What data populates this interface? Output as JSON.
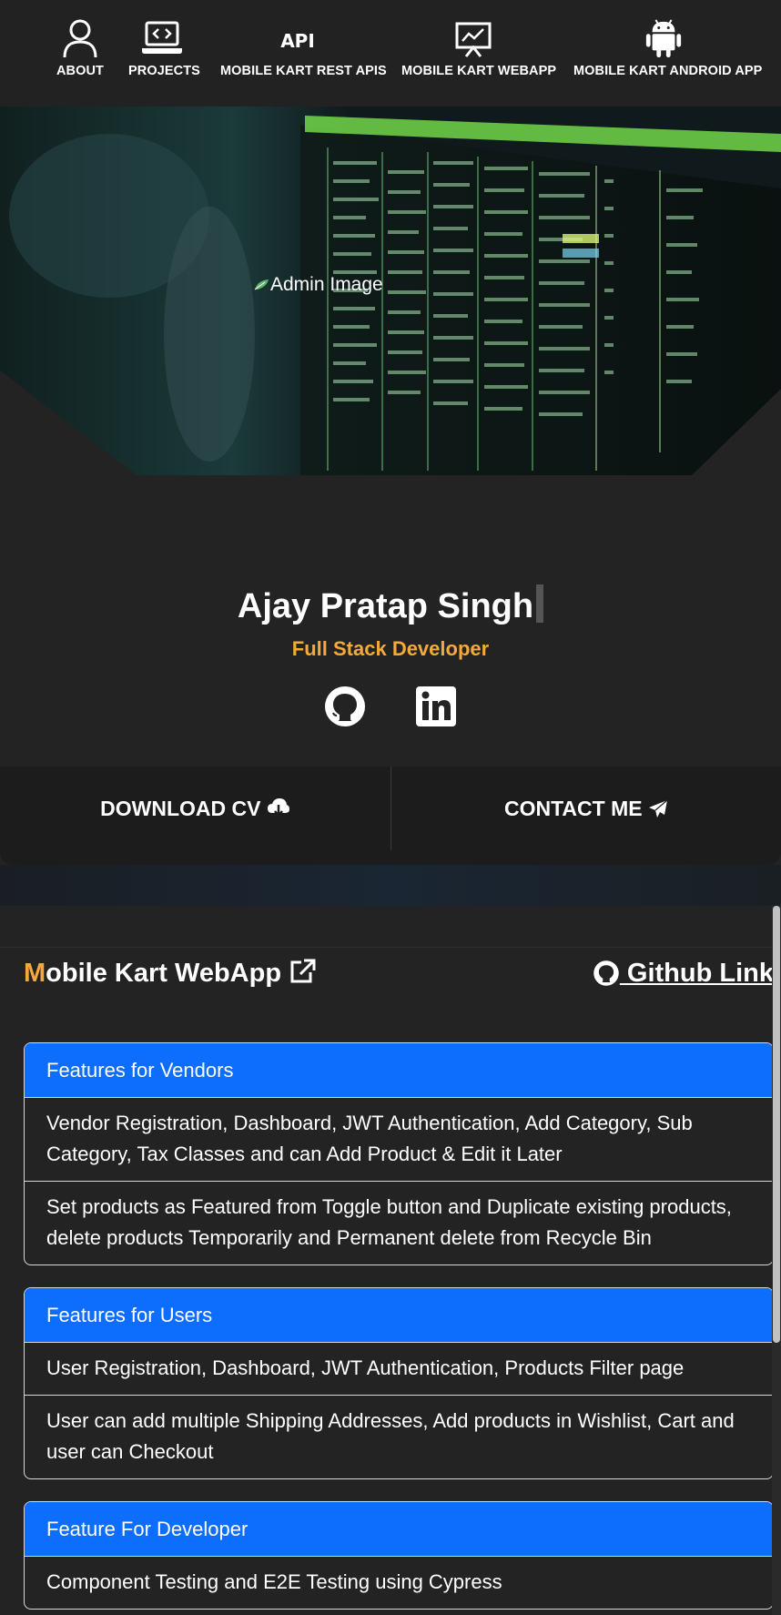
{
  "nav": {
    "items": [
      {
        "label": "ABOUT",
        "icon": "person-icon"
      },
      {
        "label": "PROJECTS",
        "icon": "laptop-code-icon"
      },
      {
        "label": "MOBILE KART REST APIS",
        "icon": "api-icon"
      },
      {
        "label": "MOBILE KART WEBAPP",
        "icon": "presentation-chart-icon"
      },
      {
        "label": "MOBILE KART ANDROID APP",
        "icon": "android-icon"
      }
    ]
  },
  "hero": {
    "image_alt": "Admin Image"
  },
  "profile": {
    "name": "Ajay Pratap Singh",
    "role": "Full Stack Developer",
    "download_label": "DOWNLOAD CV",
    "contact_label": "CONTACT ME"
  },
  "project": {
    "title_first": "M",
    "title_rest": "obile Kart WebApp",
    "github_label": " Github Link",
    "cards": [
      {
        "header": "Features for Vendors",
        "rows": [
          "Vendor Registration, Dashboard, JWT Authentication, Add Category, Sub Category, Tax Classes and can Add Product & Edit it Later",
          "Set products as Featured from Toggle button and Duplicate existing products, delete products Temporarily and Permanent delete from Recycle Bin"
        ]
      },
      {
        "header": "Features for Users",
        "rows": [
          "User Registration, Dashboard, JWT Authentication, Products Filter page",
          "User can add multiple Shipping Addresses, Add products in Wishlist, Cart and user can Checkout"
        ]
      },
      {
        "header": "Feature For Developer",
        "rows": [
          "Component Testing and E2E Testing using Cypress"
        ]
      }
    ]
  },
  "colors": {
    "accent": "#f4a93b",
    "primary": "#0d6efd",
    "background": "#232323"
  }
}
